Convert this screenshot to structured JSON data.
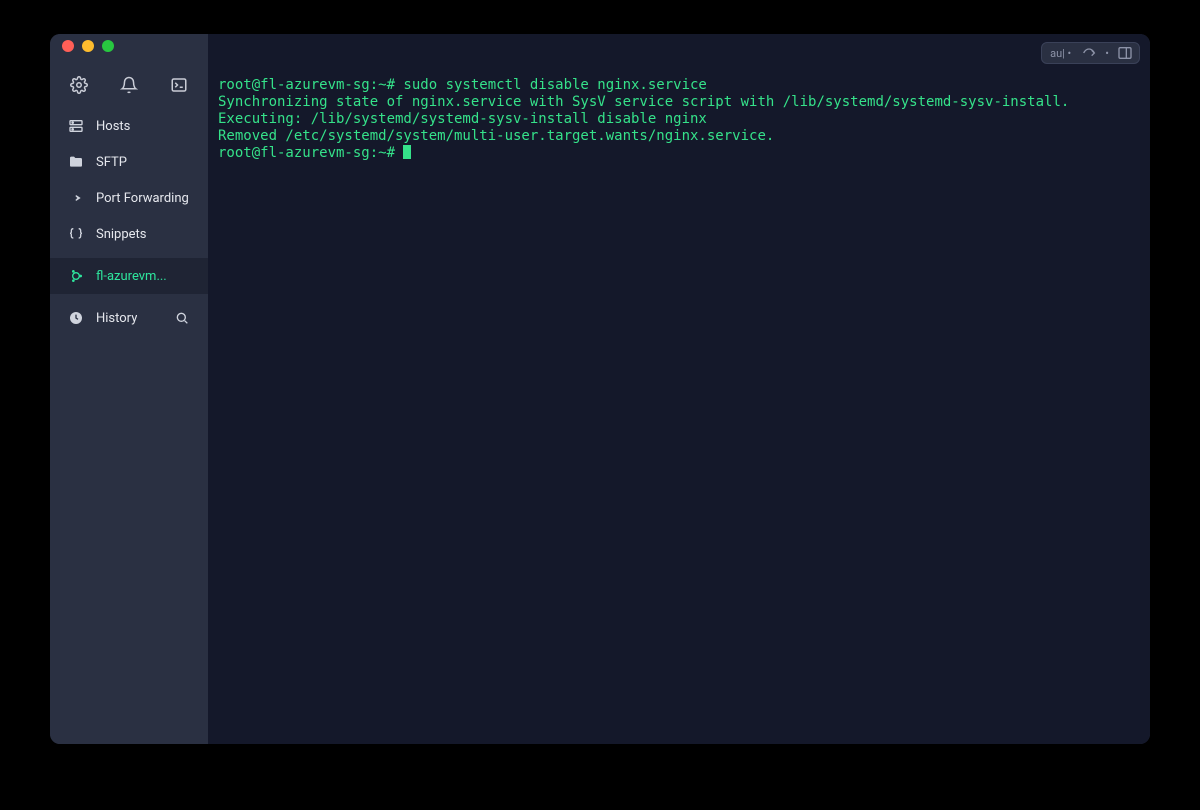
{
  "sidebar": {
    "items": [
      {
        "label": "Hosts",
        "icon": "server-icon"
      },
      {
        "label": "SFTP",
        "icon": "folder-icon"
      },
      {
        "label": "Port Forwarding",
        "icon": "forward-icon"
      },
      {
        "label": "Snippets",
        "icon": "braces-icon"
      },
      {
        "label": "fl-azurevm...",
        "icon": "ubuntu-icon",
        "active": true
      },
      {
        "label": "History",
        "icon": "clock-icon",
        "trail": "search-icon"
      }
    ]
  },
  "toolbar": {
    "mode": "au| •",
    "dot": "•"
  },
  "terminal": {
    "prompt": "root@fl-azurevm-sg:~#",
    "lines": [
      "root@fl-azurevm-sg:~# sudo systemctl disable nginx.service",
      "Synchronizing state of nginx.service with SysV service script with /lib/systemd/systemd-sysv-install.",
      "Executing: /lib/systemd/systemd-sysv-install disable nginx",
      "Removed /etc/systemd/system/multi-user.target.wants/nginx.service.",
      "root@fl-azurevm-sg:~# "
    ]
  },
  "colors": {
    "prompt": "#35e28a",
    "bg_sidebar": "#2a3042",
    "bg_terminal": "#14182a",
    "accent": "#2ee59d"
  }
}
